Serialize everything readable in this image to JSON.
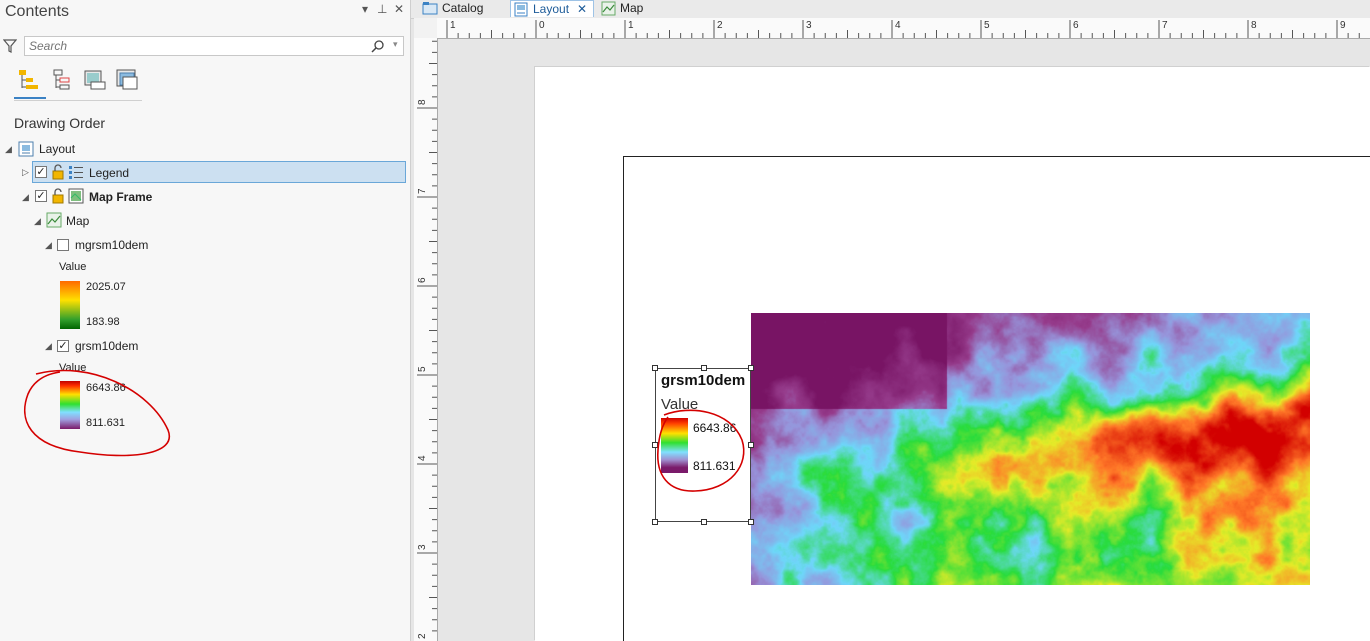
{
  "contents": {
    "title": "Contents",
    "controls": {
      "dropdown": "▾",
      "pin": "⊥",
      "close": "✕"
    },
    "search": {
      "placeholder": "Search"
    },
    "views": [
      "drawing-order-view-icon",
      "selection-view-icon",
      "data-source-view-icon",
      "snapping-view-icon"
    ],
    "section_title": "Drawing Order",
    "tree": {
      "layout_label": "Layout",
      "legend_label": "Legend",
      "map_frame_label": "Map Frame",
      "map_label": "Map",
      "layer1": {
        "name": "mgrsm10dem",
        "checked": false,
        "field": "Value",
        "high": "2025.07",
        "low": "183.98"
      },
      "layer2": {
        "name": "grsm10dem",
        "checked": true,
        "field": "Value",
        "high": "6643.86",
        "low": "811.631"
      }
    }
  },
  "tabs": [
    {
      "label": "Catalog",
      "icon": "catalog-icon"
    },
    {
      "label": "Layout",
      "icon": "layout-icon",
      "active": true
    },
    {
      "label": "Map",
      "icon": "map-icon"
    }
  ],
  "ruler": {
    "horizontal": [
      "1",
      "0",
      "1",
      "2",
      "3",
      "4",
      "5",
      "6",
      "7",
      "8",
      "9"
    ],
    "vertical": [
      "8",
      "7",
      "6",
      "5",
      "4",
      "3",
      "2"
    ]
  },
  "layout_legend": {
    "title": "grsm10dem",
    "field": "Value",
    "high": "6643.86",
    "low": "811.631"
  },
  "colors": {
    "selection_fill": "#cce0f1",
    "selection_border": "#6aa7d8",
    "annotation": "#d40000",
    "accent": "#3b82c4"
  }
}
